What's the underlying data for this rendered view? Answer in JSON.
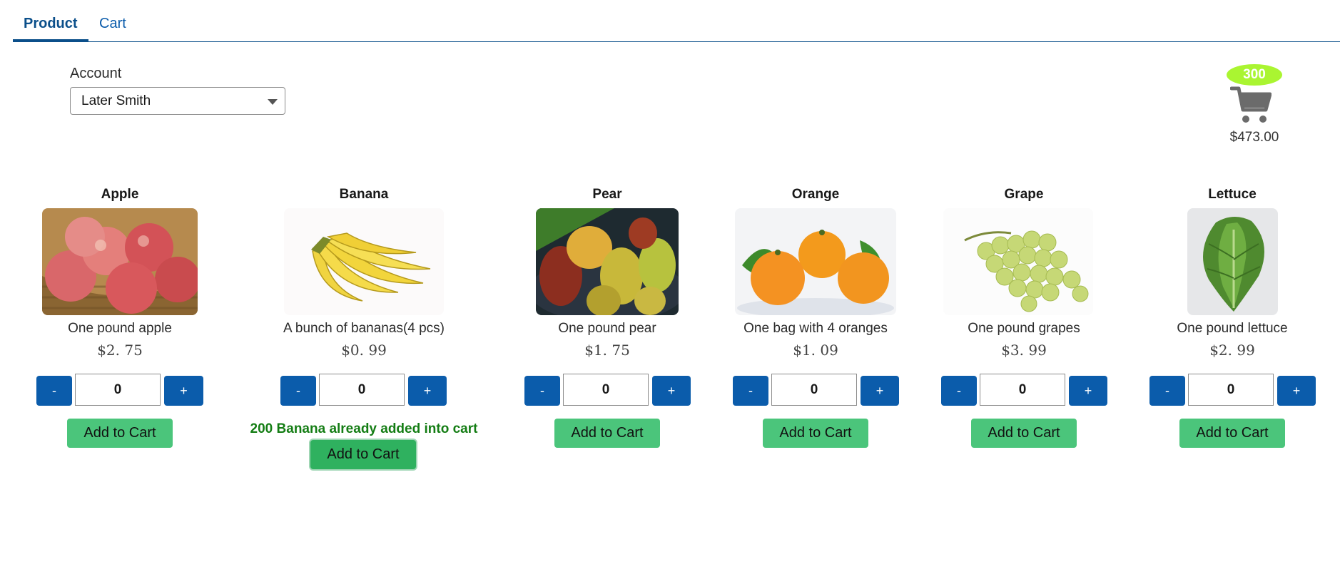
{
  "tabs": [
    {
      "label": "Product",
      "active": true
    },
    {
      "label": "Cart",
      "active": false
    }
  ],
  "account": {
    "label": "Account",
    "selected": "Later Smith"
  },
  "cart": {
    "count": "300",
    "total": "$473.00",
    "badge_color": "#aaf531",
    "icon": "shopping-cart-icon"
  },
  "products": [
    {
      "name": "Apple",
      "desc": "One pound apple",
      "price": "$2. 75",
      "qty": "0",
      "minus": "-",
      "plus": "+",
      "add_label": "Add to Cart"
    },
    {
      "name": "Banana",
      "desc": "A bunch of bananas(4 pcs)",
      "price": "$0. 99",
      "qty": "0",
      "minus": "-",
      "plus": "+",
      "add_label": "Add to Cart",
      "message": "200 Banana already added into cart"
    },
    {
      "name": "Pear",
      "desc": "One pound pear",
      "price": "$1. 75",
      "qty": "0",
      "minus": "-",
      "plus": "+",
      "add_label": "Add to Cart"
    },
    {
      "name": "Orange",
      "desc": "One bag with 4 oranges",
      "price": "$1. 09",
      "qty": "0",
      "minus": "-",
      "plus": "+",
      "add_label": "Add to Cart"
    },
    {
      "name": "Grape",
      "desc": "One pound grapes",
      "price": "$3. 99",
      "qty": "0",
      "minus": "-",
      "plus": "+",
      "add_label": "Add to Cart"
    },
    {
      "name": "Lettuce",
      "desc": "One pound lettuce",
      "price": "$2. 99",
      "qty": "0",
      "minus": "-",
      "plus": "+",
      "add_label": "Add to Cart"
    }
  ],
  "colors": {
    "brand_blue": "#0b5cab",
    "add_green": "#4bc57b",
    "message_green": "#147d14"
  }
}
